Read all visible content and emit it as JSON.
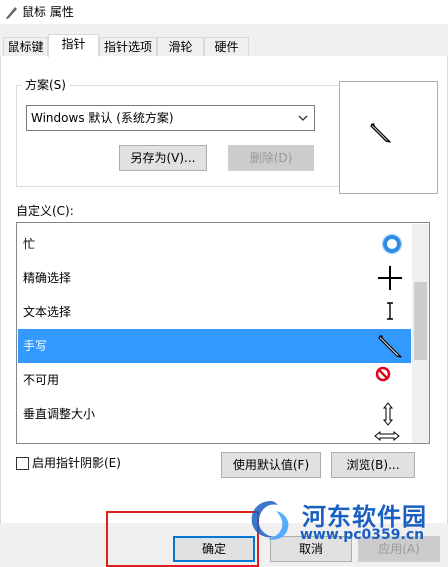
{
  "window": {
    "title": "鼠标 属性"
  },
  "tabs": [
    {
      "label": "鼠标键",
      "active": false
    },
    {
      "label": "指针",
      "active": true
    },
    {
      "label": "指针选项",
      "active": false
    },
    {
      "label": "滑轮",
      "active": false
    },
    {
      "label": "硬件",
      "active": false
    }
  ],
  "scheme": {
    "group_label": "方案(S)",
    "selected": "Windows 默认 (系统方案)",
    "save_as_label": "另存为(V)...",
    "delete_label": "删除(D)"
  },
  "custom": {
    "label": "自定义(C):",
    "items": [
      {
        "label": "忙",
        "icon": "busy-ring-icon"
      },
      {
        "label": "精确选择",
        "icon": "crosshair-icon"
      },
      {
        "label": "文本选择",
        "icon": "text-beam-icon"
      },
      {
        "label": "手写",
        "icon": "pen-icon",
        "selected": true
      },
      {
        "label": "不可用",
        "icon": "unavailable-icon"
      },
      {
        "label": "垂直调整大小",
        "icon": "vertical-resize-icon"
      }
    ]
  },
  "shadow_checkbox": {
    "label": "启用指针阴影(E)",
    "checked": false
  },
  "use_default_label": "使用默认值(F)",
  "browse_label": "浏览(B)...",
  "footer": {
    "ok_label": "确定",
    "cancel_label": "取消",
    "apply_label": "应用(A)"
  },
  "watermark": {
    "name": "河东软件园",
    "url": "www.pc0359.cn"
  },
  "colors": {
    "selection": "#3399ff",
    "busy": "#2e8ce6",
    "unavailable": "#e0001b",
    "highlight_frame": "#e02020",
    "watermark": "#1a5fc2"
  }
}
